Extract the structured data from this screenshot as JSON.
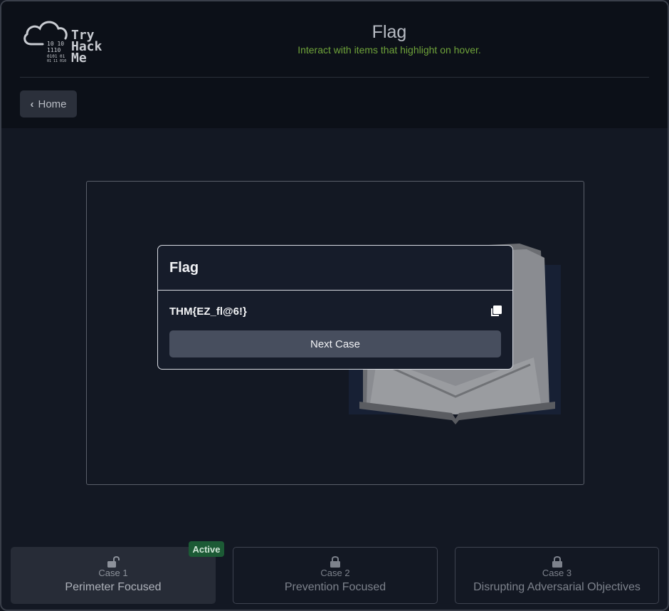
{
  "header": {
    "logo_text": "Try\nHack\nMe",
    "title": "Flag",
    "subtitle": "Interact with items that highlight on hover.",
    "home_label": "Home"
  },
  "modal": {
    "title": "Flag",
    "flag_value": "THM{EZ_fl@6!}",
    "next_label": "Next Case"
  },
  "cases": [
    {
      "number": "Case 1",
      "name": "Perimeter Focused",
      "state": "unlocked",
      "active": true
    },
    {
      "number": "Case 2",
      "name": "Prevention Focused",
      "state": "locked",
      "active": false
    },
    {
      "number": "Case 3",
      "name": "Disrupting Adversarial Objectives",
      "state": "locked",
      "active": false
    }
  ],
  "badge": {
    "label": "Active"
  },
  "colors": {
    "accent_green": "#6fa33a",
    "badge_green": "#1c5a35",
    "background": "#131823"
  }
}
